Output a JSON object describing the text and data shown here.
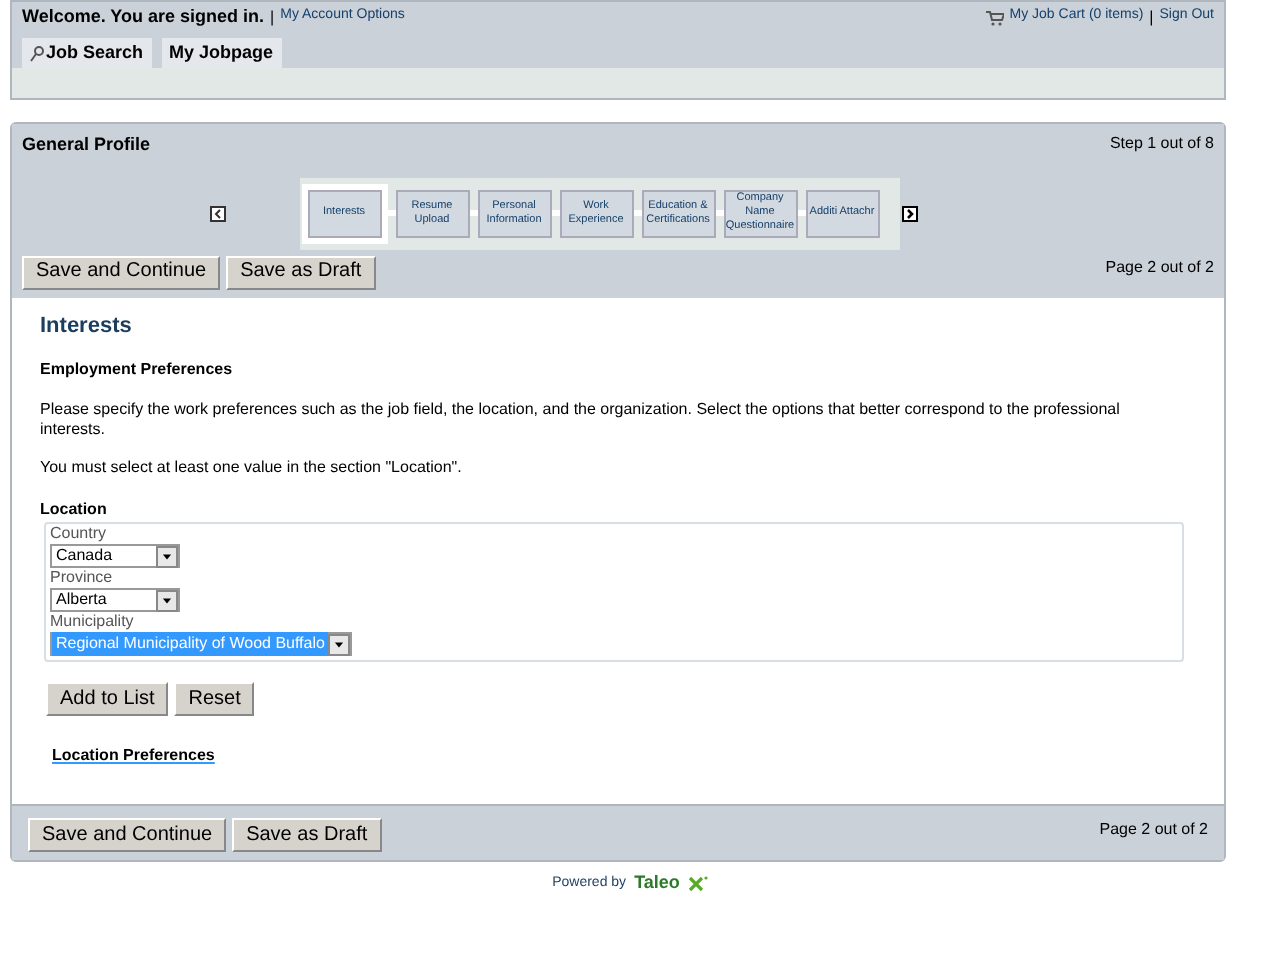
{
  "header": {
    "welcome": "Welcome. You are signed in.",
    "account_link": "My Account Options",
    "cart_link": "My Job Cart (0 items)",
    "sign_out": "Sign Out",
    "separators": [
      "|",
      "|"
    ]
  },
  "tabs": [
    {
      "label": "Job Search",
      "kind": "search",
      "selected": false
    },
    {
      "label": "My Jobpage",
      "kind": "plain",
      "selected": false
    }
  ],
  "profile": {
    "title": "General Profile",
    "step": "Step 1 out of 8",
    "page": "Page 2 out of 2",
    "steps": [
      {
        "label": "Interests",
        "selected": true
      },
      {
        "label": "Resume Upload",
        "selected": false
      },
      {
        "label": "Personal Information",
        "selected": false
      },
      {
        "label": "Work Experience",
        "selected": false
      },
      {
        "label": "Education & Certifications",
        "selected": false
      },
      {
        "label": "Company Name Questionnaire",
        "selected": false
      },
      {
        "label": "Additi Attachr",
        "selected": false
      }
    ],
    "buttons": [
      "Save and Continue",
      "Save as Draft"
    ]
  },
  "content": {
    "heading": "Interests",
    "subheading": "Employment Preferences",
    "paragraphs": [
      "Please specify the work preferences such as the job field, the location, and the organization. Select the options that better correspond to the professional interests.",
      "You must select at least one value in the section \"Location\"."
    ],
    "location": {
      "title": "Location",
      "fields": [
        {
          "label": "Country",
          "value": "Canada",
          "highlighted": false
        },
        {
          "label": "Province",
          "value": "Alberta",
          "highlighted": false
        },
        {
          "label": "Municipality",
          "value": "Regional Municipality of Wood Buffalo",
          "highlighted": true
        }
      ],
      "buttons": [
        "Add to List",
        "Reset"
      ]
    },
    "link": "Location Preferences"
  },
  "footer_bar": {
    "buttons": [
      "Save and Continue",
      "Save as Draft"
    ],
    "page": "Page 2 out of 2"
  },
  "powered": {
    "label": "Powered by",
    "brand": "Taleo"
  }
}
